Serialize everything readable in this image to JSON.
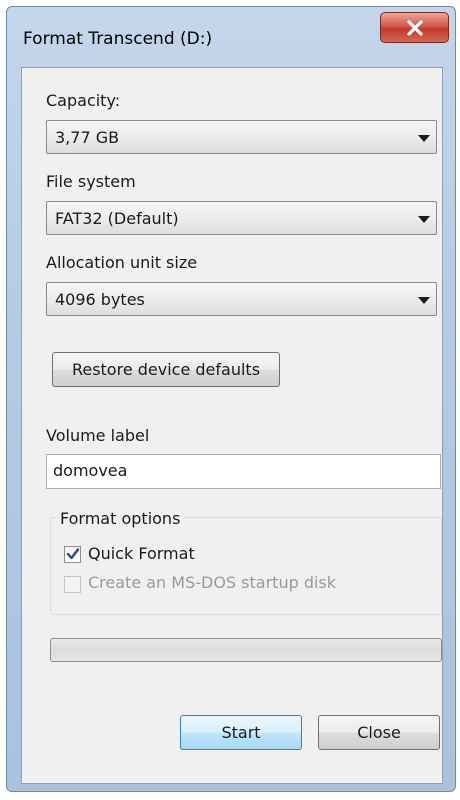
{
  "window": {
    "title": "Format Transcend (D:)"
  },
  "capacity": {
    "label": "Capacity:",
    "value": "3,77 GB"
  },
  "file_system": {
    "label": "File system",
    "value": "FAT32 (Default)"
  },
  "allocation": {
    "label": "Allocation unit size",
    "value": "4096 bytes"
  },
  "restore_button": {
    "label": "Restore device defaults"
  },
  "volume": {
    "label": "Volume label",
    "value": "domovea"
  },
  "format_options": {
    "label": "Format options",
    "quick_format": {
      "label": "Quick Format",
      "checked": true
    },
    "msdos": {
      "label": "Create an MS-DOS startup disk",
      "checked": false,
      "disabled": true
    }
  },
  "progress": {
    "value": 0
  },
  "buttons": {
    "start": "Start",
    "close": "Close"
  },
  "colors": {
    "progress_fill": "#06b025",
    "close_button": "#c23a2c"
  }
}
